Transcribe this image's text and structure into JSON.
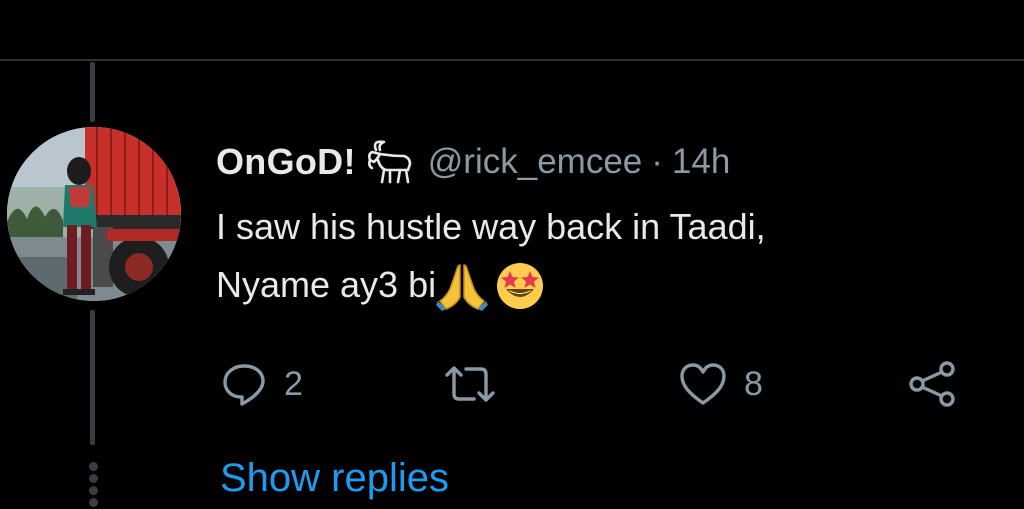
{
  "tweet": {
    "display_name": "OnGoD!",
    "handle": "@rick_emcee",
    "separator": "·",
    "timestamp": "14h",
    "text_line1": "I saw his hustle way back in Taadi,",
    "text_line2": "Nyame ay3 bi",
    "emojis": [
      "folded-hands-emoji",
      "star-struck-emoji"
    ],
    "name_emoji": "goat-emoji"
  },
  "actions": {
    "reply_count": "2",
    "retweet_count": "",
    "like_count": "8"
  },
  "show_replies_label": "Show replies",
  "colors": {
    "background": "#000000",
    "primary_text": "#e7e9ea",
    "secondary_text": "#8b98a5",
    "link": "#1d9bf0",
    "thread_line": "#3a3d40"
  }
}
